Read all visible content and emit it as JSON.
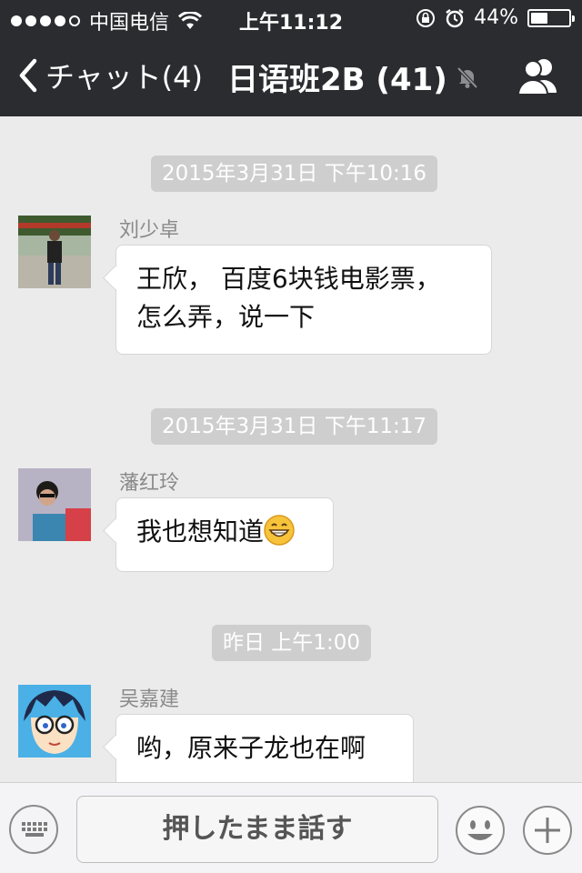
{
  "status_bar": {
    "carrier": "中国电信",
    "time": "上午11:12",
    "battery": "44%",
    "battery_level": 0.44,
    "icons": [
      "signal-dots",
      "wifi-icon",
      "rotation-lock-icon",
      "alarm-icon",
      "battery-icon"
    ]
  },
  "nav": {
    "back_label": "チャット(4)",
    "title": "日语班2B (41)",
    "icons": [
      "back-chevron-icon",
      "mute-bell-icon",
      "members-icon"
    ]
  },
  "messages": [
    {
      "timestamp": "2015年3月31日 下午10:16",
      "sender": "刘少卓",
      "text_lines": [
        "王欣，  百度6块钱电影票，",
        "怎么弄，说一下"
      ]
    },
    {
      "timestamp": "2015年3月31日 下午11:17",
      "sender": "藩红玲",
      "text": "我也想知道",
      "emoji": "grinning-face-icon"
    },
    {
      "timestamp": "昨日 上午1:00",
      "sender": "吴嘉建",
      "text": "哟，原来子龙也在啊"
    }
  ],
  "input_bar": {
    "talk_label": "押したまま話す",
    "icons": [
      "keyboard-icon",
      "emoji-face-icon",
      "plus-icon"
    ]
  },
  "colors": {
    "nav_background": "#2b2c30",
    "chat_background": "#ebebeb",
    "timestamp_pill": "#cecece"
  }
}
